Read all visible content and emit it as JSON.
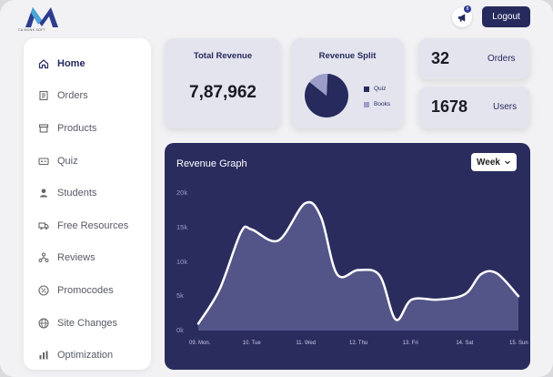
{
  "brand": {
    "logo_text": "CA MONK SOFT"
  },
  "header": {
    "notification_count": "8",
    "logout_label": "Logout"
  },
  "sidebar": {
    "items": [
      {
        "label": "Home",
        "icon": "home-icon",
        "active": true
      },
      {
        "label": "Orders",
        "icon": "orders-icon",
        "active": false
      },
      {
        "label": "Products",
        "icon": "products-icon",
        "active": false
      },
      {
        "label": "Quiz",
        "icon": "quiz-icon",
        "active": false
      },
      {
        "label": "Students",
        "icon": "students-icon",
        "active": false
      },
      {
        "label": "Free Resources",
        "icon": "truck-icon",
        "active": false
      },
      {
        "label": "Reviews",
        "icon": "reviews-icon",
        "active": false
      },
      {
        "label": "Promocodes",
        "icon": "percent-icon",
        "active": false
      },
      {
        "label": "Site Changes",
        "icon": "globe-icon",
        "active": false
      },
      {
        "label": "Optimization",
        "icon": "bar-chart-icon",
        "active": false
      }
    ]
  },
  "stats": {
    "total_revenue": {
      "title": "Total Revenue",
      "value": "7,87,962"
    },
    "revenue_split": {
      "title": "Revenue Split",
      "legend": [
        {
          "label": "Quiz",
          "color": "#262a5c"
        },
        {
          "label": "Books",
          "color": "#9c9cc9"
        }
      ]
    },
    "orders": {
      "value": "32",
      "label": "Orders"
    },
    "users": {
      "value": "1678",
      "label": "Users"
    }
  },
  "graph": {
    "title": "Revenue Graph",
    "period_select": "Week",
    "colors": {
      "background": "#2b2c5e",
      "line": "#ffffff",
      "fill": "#5a5c8f"
    }
  },
  "chart_data": [
    {
      "type": "pie",
      "title": "Revenue Split",
      "categories": [
        "Quiz",
        "Books"
      ],
      "values": [
        85,
        15
      ]
    },
    {
      "type": "area",
      "title": "Revenue Graph",
      "x_tick_labels": [
        "09. Mon.",
        "10. Tue",
        "11. Wed",
        "12. Thu",
        "13. Fri",
        "14. Sat",
        "15. Sun"
      ],
      "y_tick_labels": [
        "0k",
        "5k",
        "10k",
        "15k",
        "20k"
      ],
      "ylim": [
        0,
        20000
      ],
      "x": [
        0,
        0.4,
        0.8,
        1.0,
        1.5,
        2.0,
        2.3,
        2.6,
        3.0,
        3.4,
        3.7,
        4.0,
        4.5,
        5.0,
        5.3,
        5.6,
        6.0
      ],
      "y": [
        1000,
        6000,
        14300,
        14700,
        13100,
        18500,
        16500,
        8200,
        8800,
        8000,
        1600,
        4500,
        4500,
        5300,
        8200,
        8300,
        5000
      ]
    }
  ]
}
